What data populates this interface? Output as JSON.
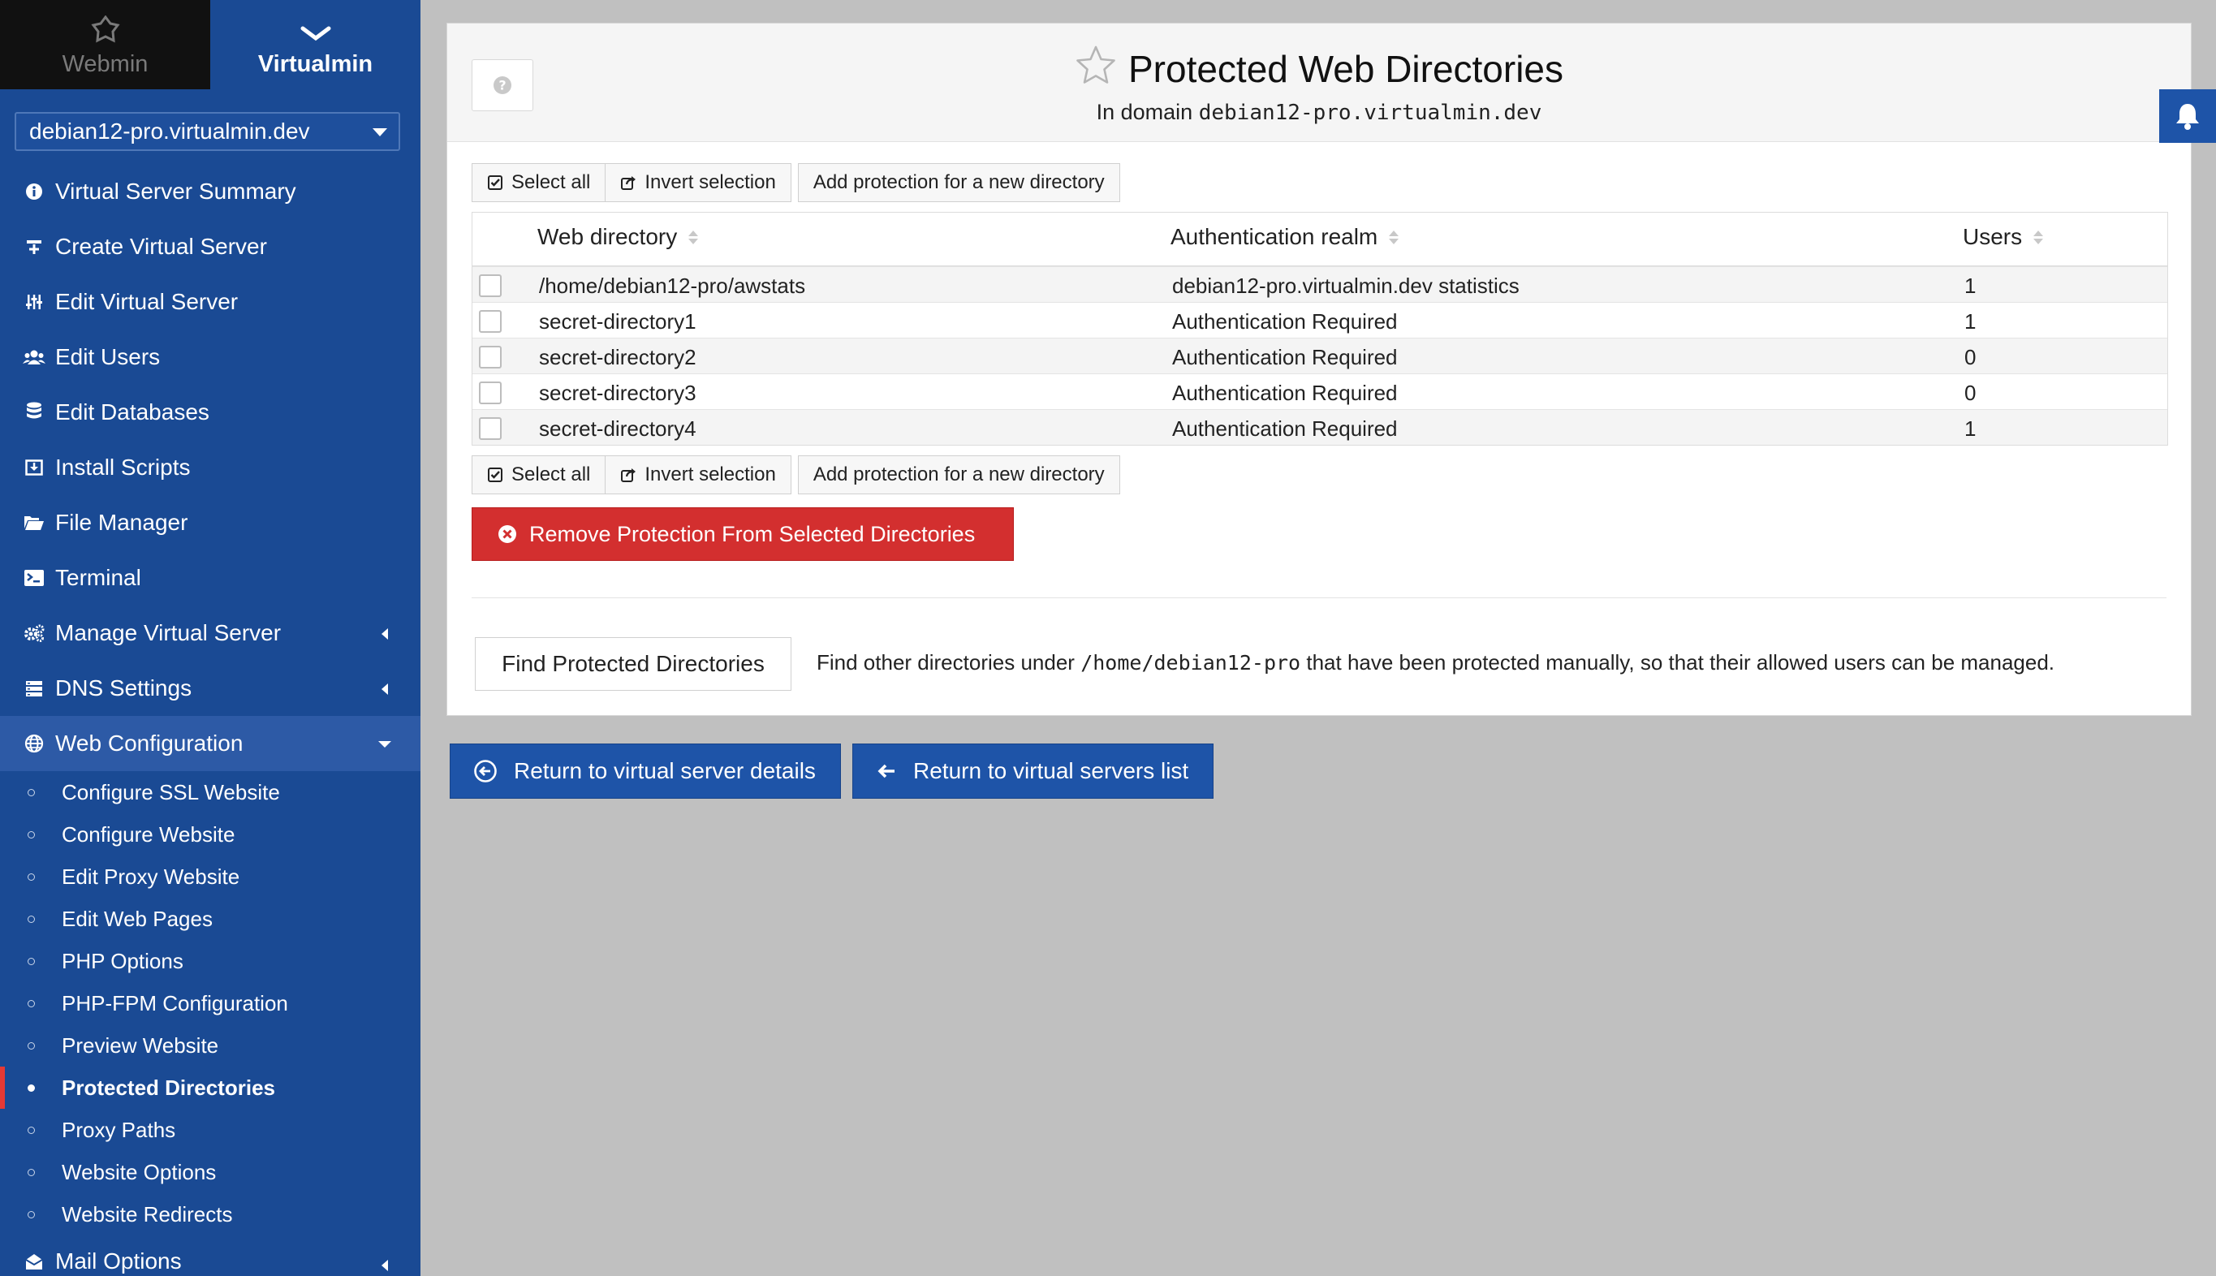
{
  "switcher": {
    "webmin_label": "Webmin",
    "virtualmin_label": "Virtualmin"
  },
  "domain_select": {
    "value": "debian12-pro.virtualmin.dev"
  },
  "menu": {
    "items": [
      {
        "label": "Virtual Server Summary",
        "icon": "info-circle-icon"
      },
      {
        "label": "Create Virtual Server",
        "icon": "plus-server-icon"
      },
      {
        "label": "Edit Virtual Server",
        "icon": "sliders-icon"
      },
      {
        "label": "Edit Users",
        "icon": "users-icon"
      },
      {
        "label": "Edit Databases",
        "icon": "database-icon"
      },
      {
        "label": "Install Scripts",
        "icon": "download-box-icon"
      },
      {
        "label": "File Manager",
        "icon": "folders-icon"
      },
      {
        "label": "Terminal",
        "icon": "terminal-icon"
      },
      {
        "label": "Manage Virtual Server",
        "icon": "cogs-icon"
      },
      {
        "label": "DNS Settings",
        "icon": "server-stack-icon"
      },
      {
        "label": "Web Configuration",
        "icon": "globe-icon"
      }
    ],
    "web_sub": [
      "Configure SSL Website",
      "Configure Website",
      "Edit Proxy Website",
      "Edit Web Pages",
      "PHP Options",
      "PHP-FPM Configuration",
      "Preview Website",
      "Protected Directories",
      "Proxy Paths",
      "Website Options",
      "Website Redirects"
    ],
    "mail_options": "Mail Options"
  },
  "page": {
    "title": "Protected Web Directories",
    "subtitle_prefix": "In domain",
    "subtitle_domain": "debian12-pro.virtualmin.dev"
  },
  "toolbar": {
    "select_all": "Select all",
    "invert_selection": "Invert selection",
    "add_protection": "Add protection for a new directory"
  },
  "table": {
    "headers": {
      "dir": "Web directory",
      "realm": "Authentication realm",
      "users": "Users"
    },
    "rows": [
      {
        "dir": "/home/debian12-pro/awstats",
        "realm": "debian12-pro.virtualmin.dev statistics",
        "users": "1"
      },
      {
        "dir": "secret-directory1",
        "realm": "Authentication Required",
        "users": "1"
      },
      {
        "dir": "secret-directory2",
        "realm": "Authentication Required",
        "users": "0"
      },
      {
        "dir": "secret-directory3",
        "realm": "Authentication Required",
        "users": "0"
      },
      {
        "dir": "secret-directory4",
        "realm": "Authentication Required",
        "users": "1"
      }
    ]
  },
  "remove_button": "Remove Protection From Selected Directories",
  "find": {
    "button": "Find Protected Directories",
    "desc_before": "Find other directories under",
    "desc_path": "/home/debian12-pro",
    "desc_after": "that have been protected manually, so that their allowed users can be managed."
  },
  "return": {
    "details": "Return to virtual server details",
    "list": "Return to virtual servers list"
  },
  "colors": {
    "sidebar": "#1a4a94",
    "danger": "#d32f2f",
    "primary": "#1e54a8",
    "active_marker": "#e53935"
  }
}
